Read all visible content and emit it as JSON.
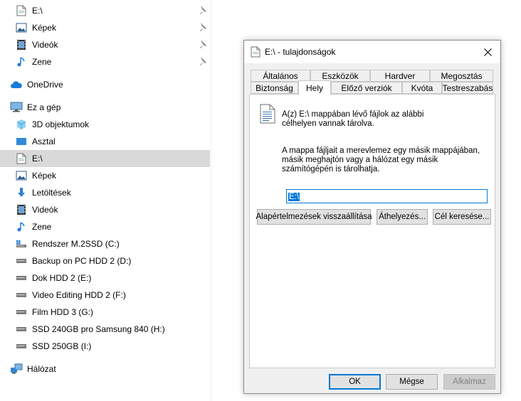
{
  "nav": {
    "quick_access": [
      {
        "label": "E:\\",
        "icon": "drive-icon",
        "pinned": true
      },
      {
        "label": "Képek",
        "icon": "pictures-icon",
        "pinned": true
      },
      {
        "label": "Videók",
        "icon": "videos-icon",
        "pinned": true
      },
      {
        "label": "Zene",
        "icon": "music-icon",
        "pinned": true
      }
    ],
    "onedrive": {
      "label": "OneDrive",
      "icon": "cloud-icon"
    },
    "this_pc": {
      "label": "Ez a gép",
      "icon": "computer-icon"
    },
    "this_pc_items": [
      {
        "label": "3D objektumok",
        "icon": "3d-objects-icon"
      },
      {
        "label": "Asztal",
        "icon": "desktop-icon"
      },
      {
        "label": "E:\\",
        "icon": "drive-icon",
        "selected": true
      },
      {
        "label": "Képek",
        "icon": "pictures-icon"
      },
      {
        "label": "Letöltések",
        "icon": "downloads-icon"
      },
      {
        "label": "Videók",
        "icon": "videos-icon"
      },
      {
        "label": "Zene",
        "icon": "music-icon"
      },
      {
        "label": "Rendszer M.2SSD (C:)",
        "icon": "system-drive-icon"
      },
      {
        "label": "Backup on PC HDD 2 (D:)",
        "icon": "hard-drive-icon"
      },
      {
        "label": "Dok HDD 2 (E:)",
        "icon": "hard-drive-icon"
      },
      {
        "label": "Video Editing HDD 2 (F:)",
        "icon": "hard-drive-icon"
      },
      {
        "label": "Film HDD 3 (G:)",
        "icon": "hard-drive-icon"
      },
      {
        "label": "SSD 240GB pro Samsung 840 (H:)",
        "icon": "hard-drive-icon"
      },
      {
        "label": "SSD 250GB (I:)",
        "icon": "hard-drive-icon"
      }
    ],
    "network": {
      "label": "Hálózat",
      "icon": "network-icon"
    }
  },
  "dialog": {
    "title": "E:\\ - tulajdonságok",
    "tabs_row1": [
      "Általános",
      "Eszközök",
      "Hardver",
      "Megosztás"
    ],
    "tabs_row2": [
      "Biztonság",
      "Hely",
      "Előző verziók",
      "Kvóta",
      "Testreszabás"
    ],
    "active_tab": "Hely",
    "description": "A(z) E:\\ mappában lévő fájlok az alábbi célhelyen vannak tárolva.",
    "explanation": "A mappa fájljait a merevlemez egy másik mappájában, másik meghajtón vagy a hálózat egy másik számítógépén is tárolhatja.",
    "location_value": "E:\\",
    "buttons": {
      "restore": "Alapértelmezések visszaállítása",
      "move": "Áthelyezés...",
      "find": "Cél keresése...",
      "ok": "OK",
      "cancel": "Mégse",
      "apply": "Alkalmaz"
    }
  },
  "colors": {
    "selection": "#d9d9d9",
    "accent": "#0078d7",
    "dialog_bg": "#f0f0f0"
  }
}
